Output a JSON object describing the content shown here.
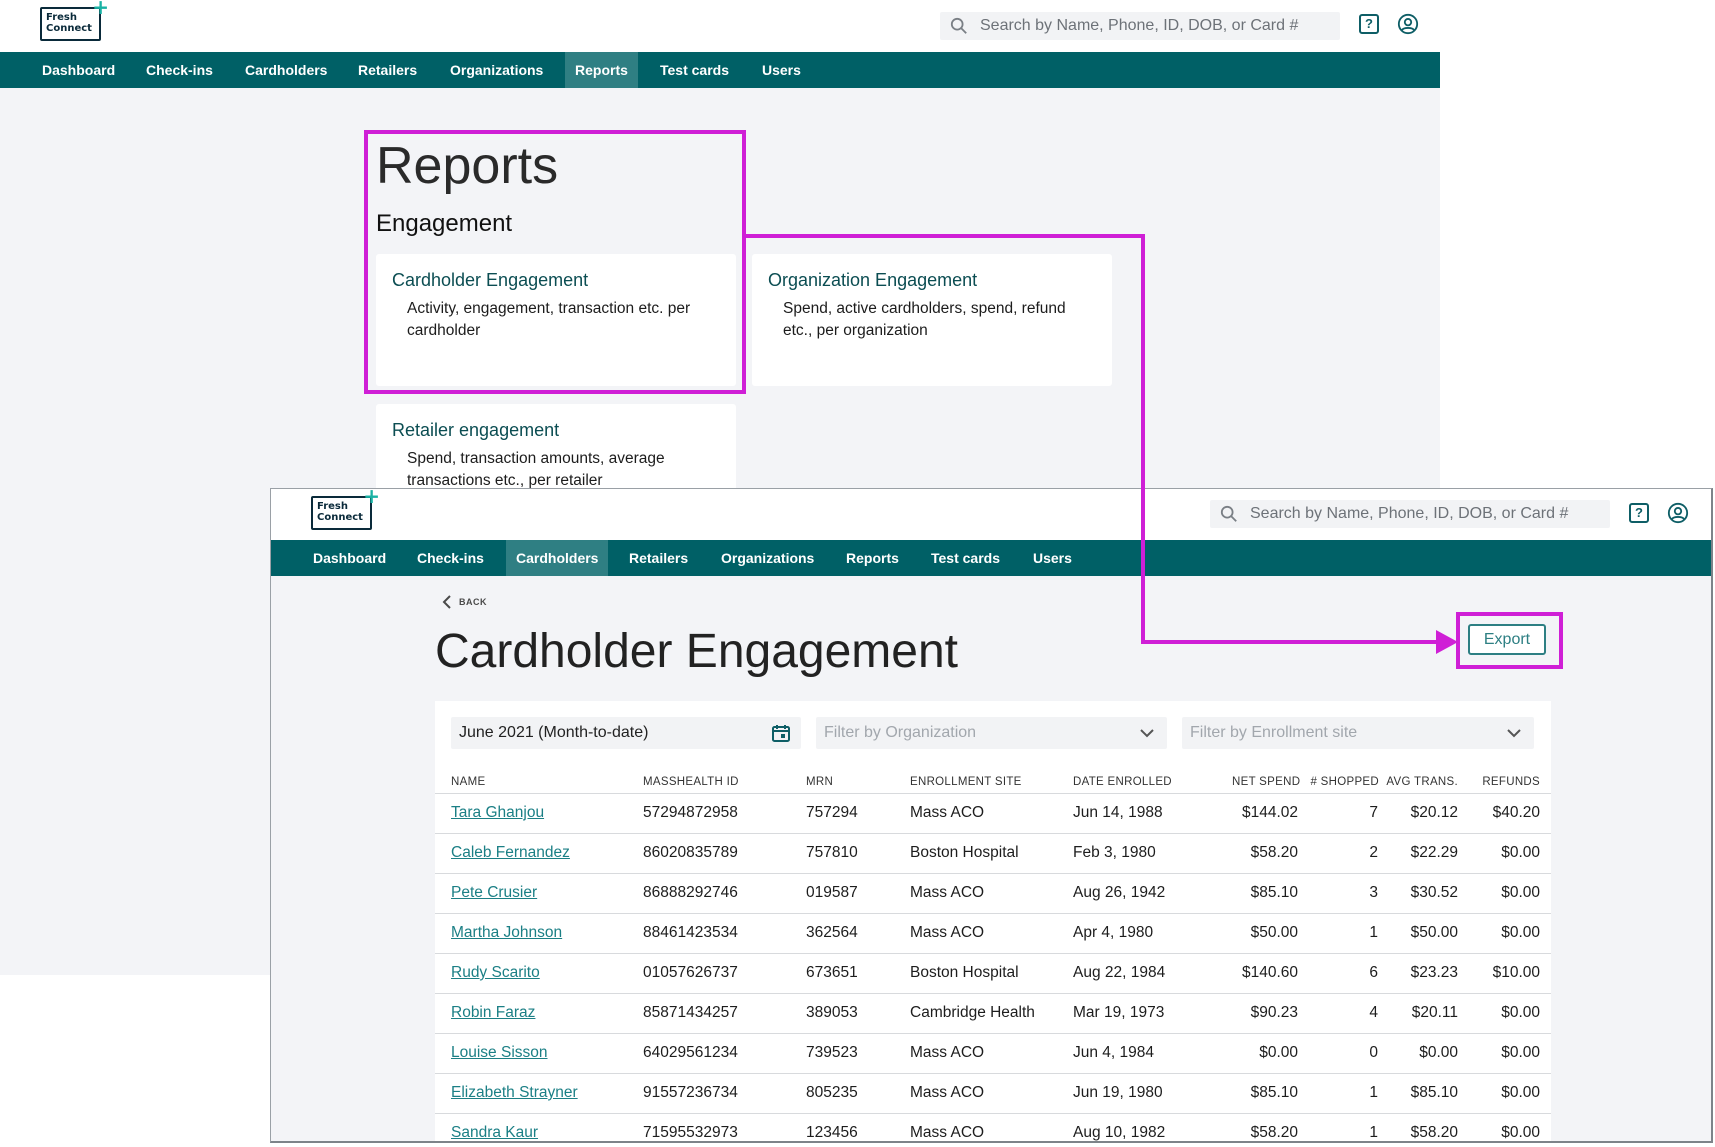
{
  "brand": {
    "logo_line1": "Fresh",
    "logo_line2": "Connect",
    "logo_plus": "+"
  },
  "search": {
    "placeholder": "Search by Name, Phone, ID, DOB, or Card #"
  },
  "icons": {
    "help": "?"
  },
  "back_nav": {
    "items": [
      "Dashboard",
      "Check-ins",
      "Cardholders",
      "Retailers",
      "Organizations",
      "Reports",
      "Test cards",
      "Users"
    ],
    "active": "Reports"
  },
  "reports": {
    "title": "Reports",
    "section": "Engagement",
    "cards": [
      {
        "title": "Cardholder Engagement",
        "desc": "Activity, engagement, transaction etc. per cardholder"
      },
      {
        "title": "Organization Engagement",
        "desc": "Spend, active cardholders, spend, refund etc., per organization"
      },
      {
        "title": "Retailer engagement",
        "desc": "Spend, transaction amounts, average transactions etc., per retailer"
      }
    ]
  },
  "front_nav": {
    "items": [
      "Dashboard",
      "Check-ins",
      "Cardholders",
      "Retailers",
      "Organizations",
      "Reports",
      "Test cards",
      "Users"
    ],
    "active": "Cardholders"
  },
  "engagement": {
    "back_label": "BACK",
    "title": "Cardholder Engagement",
    "export_label": "Export",
    "date_filter": "June 2021 (Month-to-date)",
    "org_filter_placeholder": "Filter by Organization",
    "site_filter_placeholder": "Filter by Enrollment site",
    "columns": [
      "NAME",
      "MASSHEALTH ID",
      "MRN",
      "ENROLLMENT SITE",
      "DATE ENROLLED",
      "NET SPEND",
      "# SHOPPED",
      "AVG TRANS.",
      "REFUNDS"
    ],
    "rows": [
      {
        "name": "Tara Ghanjou",
        "masshealth_id": "57294872958",
        "mrn": "757294",
        "site": "Mass ACO",
        "date": "Jun 14, 1988",
        "net_spend": "$144.02",
        "shopped": "7",
        "avg": "$20.12",
        "refunds": "$40.20"
      },
      {
        "name": "Caleb Fernandez",
        "masshealth_id": "86020835789",
        "mrn": "757810",
        "site": "Boston Hospital",
        "date": "Feb 3, 1980",
        "net_spend": "$58.20",
        "shopped": "2",
        "avg": "$22.29",
        "refunds": "$0.00"
      },
      {
        "name": "Pete Crusier",
        "masshealth_id": "86888292746",
        "mrn": "019587",
        "site": "Mass ACO",
        "date": "Aug 26, 1942",
        "net_spend": "$85.10",
        "shopped": "3",
        "avg": "$30.52",
        "refunds": "$0.00"
      },
      {
        "name": "Martha Johnson",
        "masshealth_id": "88461423534",
        "mrn": "362564",
        "site": "Mass ACO",
        "date": "Apr 4, 1980",
        "net_spend": "$50.00",
        "shopped": "1",
        "avg": "$50.00",
        "refunds": "$0.00"
      },
      {
        "name": "Rudy Scarito",
        "masshealth_id": "01057626737",
        "mrn": "673651",
        "site": "Boston Hospital",
        "date": "Aug 22, 1984",
        "net_spend": "$140.60",
        "shopped": "6",
        "avg": "$23.23",
        "refunds": "$10.00"
      },
      {
        "name": "Robin Faraz",
        "masshealth_id": "85871434257",
        "mrn": "389053",
        "site": "Cambridge Health",
        "date": "Mar 19, 1973",
        "net_spend": "$90.23",
        "shopped": "4",
        "avg": "$20.11",
        "refunds": "$0.00"
      },
      {
        "name": "Louise Sisson",
        "masshealth_id": "64029561234",
        "mrn": "739523",
        "site": "Mass ACO",
        "date": "Jun 4, 1984",
        "net_spend": "$0.00",
        "shopped": "0",
        "avg": "$0.00",
        "refunds": "$0.00"
      },
      {
        "name": "Elizabeth Strayner",
        "masshealth_id": "91557236734",
        "mrn": "805235",
        "site": "Mass ACO",
        "date": "Jun 19, 1980",
        "net_spend": "$85.10",
        "shopped": "1",
        "avg": "$85.10",
        "refunds": "$0.00"
      },
      {
        "name": "Sandra Kaur",
        "masshealth_id": "71595532973",
        "mrn": "123456",
        "site": "Mass ACO",
        "date": "Aug 10, 1982",
        "net_spend": "$58.20",
        "shopped": "1",
        "avg": "$58.20",
        "refunds": "$0.00"
      }
    ]
  },
  "colors": {
    "nav_bg": "#006066",
    "nav_active": "#2f7f83",
    "link": "#1b7f85",
    "annotation": "#cf1fd6",
    "page_bg": "#f3f4f7"
  }
}
